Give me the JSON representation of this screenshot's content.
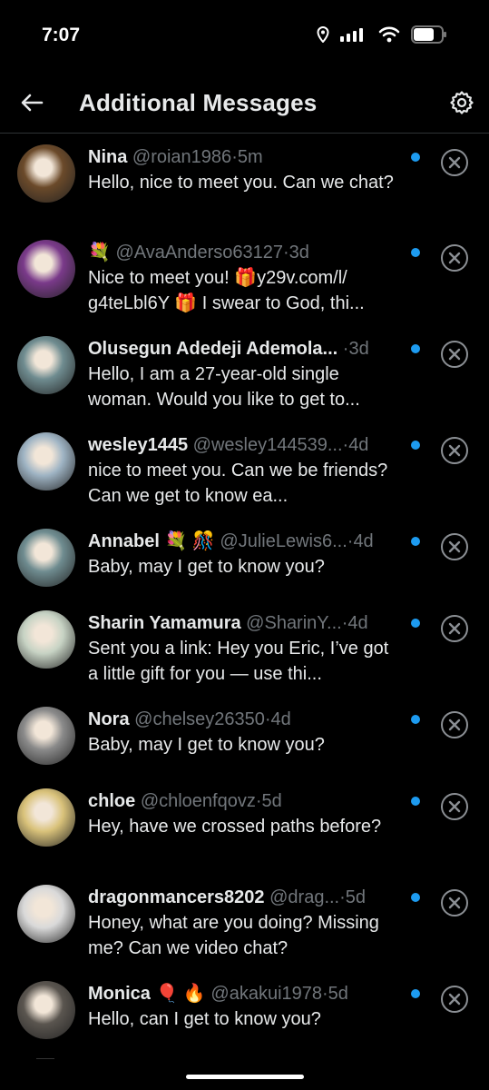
{
  "status_bar": {
    "time": "7:07",
    "icons": [
      "location-icon",
      "signal-icon",
      "wifi-icon",
      "battery-icon"
    ]
  },
  "header": {
    "title": "Additional Messages",
    "back_icon": "arrow-left-icon",
    "settings_icon": "gear-icon"
  },
  "colors": {
    "background": "#000000",
    "unread_dot": "#1d9bf0",
    "secondary_text": "#71767b",
    "primary_text": "#e7e9ea"
  },
  "conversations": [
    {
      "name": "Nina",
      "handle": "@roian1986",
      "time": "5m",
      "message": "Hello, nice to meet you. Can we chat?",
      "avatar_color": "#6b4a2a"
    },
    {
      "name": "💐",
      "handle": "@AvaAnderso63127",
      "time": "3d",
      "message": "Nice to meet you! 🎁y29v.com/l/ g4teLbl6Y 🎁 I swear to God, thi...",
      "avatar_color": "#7a3a8a"
    },
    {
      "name": "Olusegun Adedeji Ademola...",
      "handle": "",
      "time": "3d",
      "message": "Hello, I am a 27-year-old single woman. Would you like to get to...",
      "avatar_color": "#6f8c90"
    },
    {
      "name": "wesley1445",
      "handle": "@wesley144539...",
      "time": "4d",
      "message": "nice to meet you. Can we be friends? Can we get to know ea...",
      "avatar_color": "#9fb4c4"
    },
    {
      "name": "Annabel 💐 🎊",
      "handle": "@JulieLewis6...",
      "time": "4d",
      "message": "Baby, may I get to know you?",
      "avatar_color": "#6f8c90"
    },
    {
      "name": "Sharin Yamamura",
      "handle": "@SharinY...",
      "time": "4d",
      "message": "Sent you a link: Hey you Eric, I’ve got a little gift for you — use thi...",
      "avatar_color": "#c7d3c4"
    },
    {
      "name": "Nora",
      "handle": "@chelsey26350",
      "time": "4d",
      "message": "Baby, may I get to know you?",
      "avatar_color": "#8a8a8a"
    },
    {
      "name": "chloe",
      "handle": "@chloenfqovz",
      "time": "5d",
      "message": "Hey, have we crossed paths before?",
      "avatar_color": "#d9c27a"
    },
    {
      "name": "dragonmancers8202",
      "handle": "@drag...",
      "time": "5d",
      "message": "Honey, what are you doing? Missing me? Can we video chat?",
      "avatar_color": "#d9d9d9"
    },
    {
      "name": "Monica 🎈 🔥",
      "handle": "@akakui1978",
      "time": "5d",
      "message": "Hello, can I get to know you?",
      "avatar_color": "#5a554f"
    }
  ]
}
